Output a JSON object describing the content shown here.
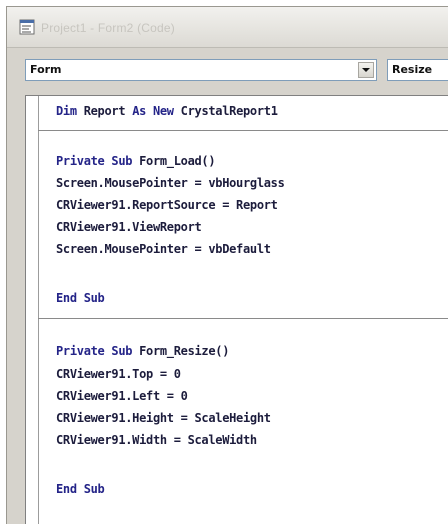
{
  "window": {
    "title": "Project1 - Form2 (Code)"
  },
  "object_combo": {
    "value": "Form"
  },
  "procedure_combo": {
    "value": "Resize"
  },
  "code": {
    "line1": {
      "kw": "Dim",
      "t1": " Report ",
      "kw2": "As New",
      "t2": " CrystalReport1"
    },
    "load": {
      "sig_kw": "Private Sub",
      "sig_name": " Form_Load()",
      "l1": "Screen.MousePointer = vbHourglass",
      "l2": "CRViewer91.ReportSource = Report",
      "l3": "CRViewer91.ViewReport",
      "l4": "Screen.MousePointer = vbDefault",
      "end": "End Sub"
    },
    "resize": {
      "sig_kw": "Private Sub",
      "sig_name": " Form_Resize()",
      "l1": "CRViewer91.Top = 0",
      "l2": "CRViewer91.Left = 0",
      "l3": "CRViewer91.Height = ScaleHeight",
      "l4": "CRViewer91.Width = ScaleWidth",
      "end": "End Sub"
    }
  }
}
